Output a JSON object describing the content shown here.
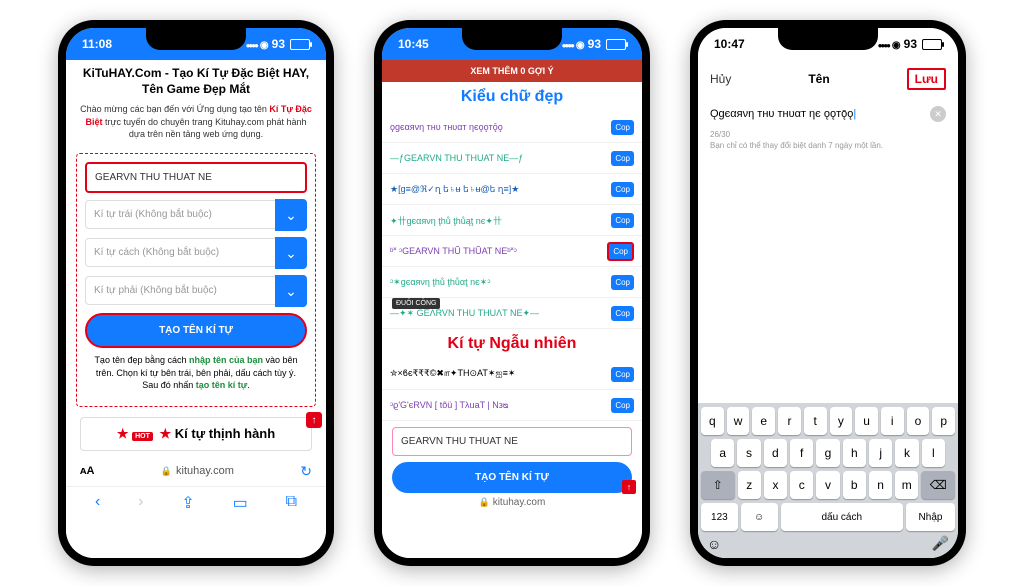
{
  "phone1": {
    "time": "11:08",
    "battery": "93",
    "title": "KiTuHAY.Com - Tạo Kí Tự Đặc Biệt HAY, Tên Game Đẹp Mắt",
    "intro_pre": "Chào mừng các bạn đến với Ứng dụng tạo tên ",
    "intro_red": "Kí Tự Đặc Biệt",
    "intro_mid": " trực tuyến do chuyên trang Kituhay.com phát hành dựa trên nền tảng web ứng dụng.",
    "input_main": "GEARVN THU THUAT NE",
    "sel1": "Kí tự trái (Không bắt buộc)",
    "sel2": "Kí tự cách (Không bắt buộc)",
    "sel3": "Kí tự phải (Không bắt buộc)",
    "create_btn": "TẠO TÊN KÍ TỰ",
    "help_pre": "Tạo tên đẹp bằng cách ",
    "help_g1": "nhập tên của bạn",
    "help_mid": " vào bên trên. Chọn kí tự bên trái, bên phải, dấu cách tùy ý. Sau đó nhấn ",
    "help_g2": "tạo tên kí tự",
    "hot_star": "★",
    "hot_label": "HOT",
    "hot_text": "Kí tự thịnh hành",
    "aa": "ᴀA",
    "url": "kituhay.com"
  },
  "phone2": {
    "time": "10:45",
    "battery": "93",
    "crimson": "XEM THÊM 0 GỢI Ý",
    "h1": "Kiểu chữ đẹp",
    "styles": [
      {
        "text": "ϙgєαяνη тнυ тнυαт ηєǫǫтǭǫ",
        "cls": "purple"
      },
      {
        "text": "—ƒGEARVN THU THUAT NE—ƒ",
        "cls": "teal"
      },
      {
        "text": "★[g≡@ℜ✓ղ ե♄ʉ ե♄ʉ@ե ղ≡]★",
        "cls": "dblue"
      },
      {
        "text": "✦卄gєαяνη ţhů ţhůąţ nє✦卄",
        "cls": "teal"
      },
      {
        "text": "ᵇ˟ ᵓGEARVN THŨ THŨAT NEᵇ˟ᵓ",
        "cls": "purple",
        "rb": true
      },
      {
        "text": "ᵓ✶gєαяνη ţhů ţhůαţ nє✶ᵓ",
        "cls": "teal"
      },
      {
        "text": "—✦✶ GEΛRVN THU THUΛT NE✦—",
        "cls": "teal"
      }
    ],
    "h2": "Kí tự Ngẫu nhiên",
    "rand": [
      {
        "text": "✮×ϐє₹₹₹©✖௱✦TH⊙AT✶ஐ≡✶",
        "cls": ""
      },
      {
        "text": "ᵓϱ'G'єRVN [ tõü ] TλuaT | Nзᴓ",
        "cls": "purple"
      }
    ],
    "input2": "GEARVN THU THUAT NE",
    "create_btn": "TẠO TÊN KÍ TỰ",
    "url": "kituhay.com",
    "copy": "Cop",
    "tip": "ĐUÔI CÔNG"
  },
  "phone3": {
    "time": "10:47",
    "battery": "93",
    "cancel": "Hủy",
    "title": "Tên",
    "save": "Lưu",
    "name_value": "Ǫgєαяνη тнυ тнυαт ηє ǫǫтǭǫ",
    "counter": "26/30",
    "hint": "Bạn chỉ có thể thay đổi biệt danh 7 ngày một lần.",
    "keys_r1": [
      "q",
      "w",
      "e",
      "r",
      "t",
      "y",
      "u",
      "i",
      "o",
      "p"
    ],
    "keys_r2": [
      "a",
      "s",
      "d",
      "f",
      "g",
      "h",
      "j",
      "k",
      "l"
    ],
    "keys_r3": [
      "z",
      "x",
      "c",
      "v",
      "b",
      "n",
      "m"
    ],
    "key_123": "123",
    "key_space": "dấu cách",
    "key_return": "Nhập"
  }
}
